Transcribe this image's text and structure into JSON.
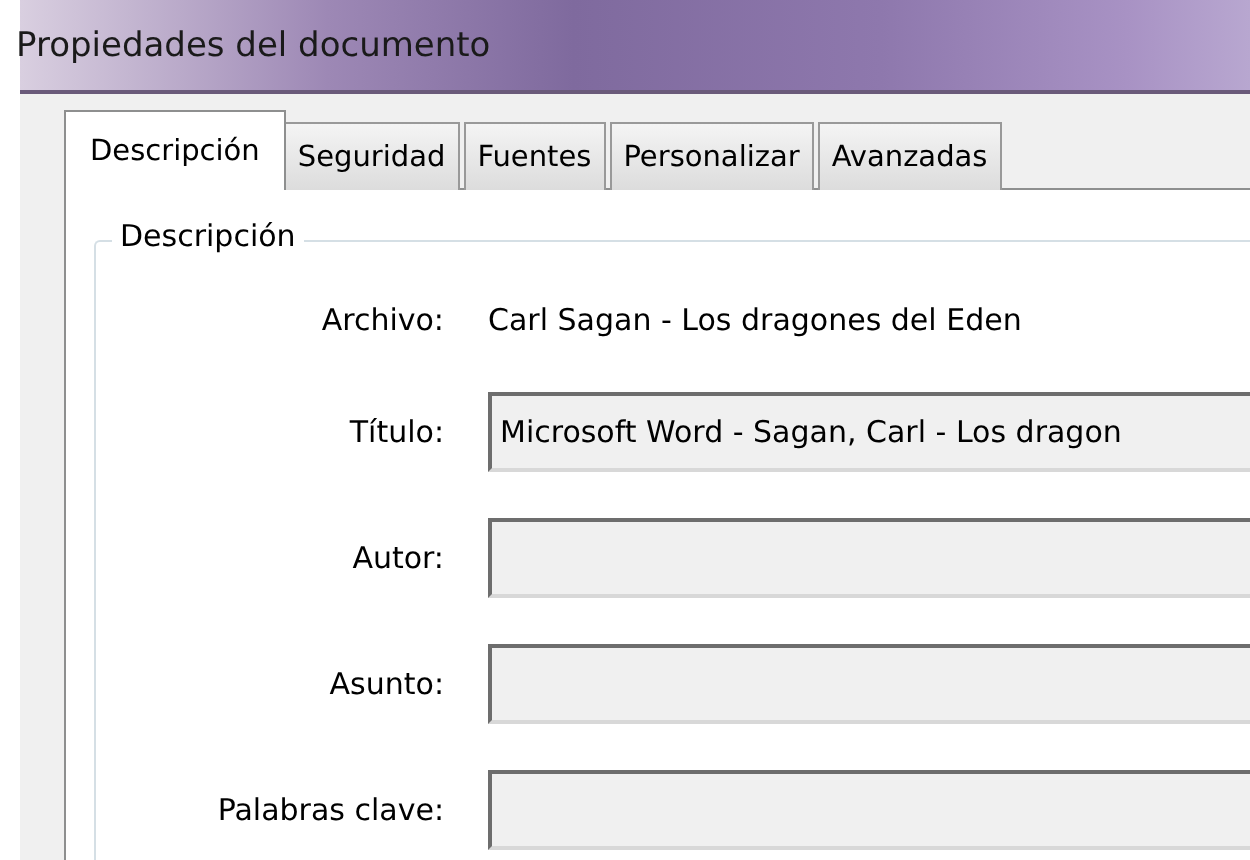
{
  "window": {
    "title": "Propiedades del documento"
  },
  "tabs": [
    {
      "label": "Descripción",
      "selected": true
    },
    {
      "label": "Seguridad",
      "selected": false
    },
    {
      "label": "Fuentes",
      "selected": false
    },
    {
      "label": "Personalizar",
      "selected": false
    },
    {
      "label": "Avanzadas",
      "selected": false
    }
  ],
  "group": {
    "title": "Descripción"
  },
  "fields": [
    {
      "kind": "text",
      "label": "Archivo:",
      "value": "Carl Sagan - Los dragones del Eden"
    },
    {
      "kind": "field",
      "label": "Título:",
      "value": "Microsoft Word - Sagan, Carl - Los dragon"
    },
    {
      "kind": "field",
      "label": "Autor:"
    },
    {
      "kind": "field",
      "label": "Asunto:"
    },
    {
      "kind": "field",
      "label": "Palabras clave:"
    }
  ]
}
